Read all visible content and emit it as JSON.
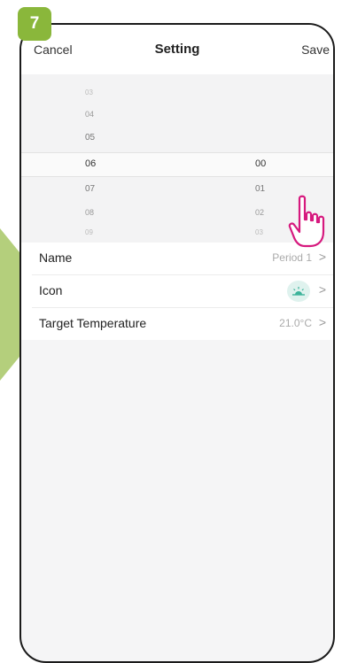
{
  "step": "7",
  "nav": {
    "cancel_label": "Cancel",
    "title": "Setting",
    "save_label": "Save"
  },
  "picker": {
    "hours": [
      "03",
      "04",
      "05",
      "06",
      "07",
      "08",
      "09"
    ],
    "minutes": [
      "00",
      "01",
      "02",
      "03"
    ],
    "selected_hour": "06",
    "selected_minute": "00"
  },
  "settings": [
    {
      "label": "Name",
      "value": "Period 1"
    },
    {
      "label": "Icon",
      "icon": "sunrise-icon"
    },
    {
      "label": "Target Temperature",
      "value": "21.0°C"
    }
  ],
  "colors": {
    "accent_green": "#8ab73b",
    "hand_pink": "#d6197e",
    "icon_teal": "#3cb39a"
  }
}
